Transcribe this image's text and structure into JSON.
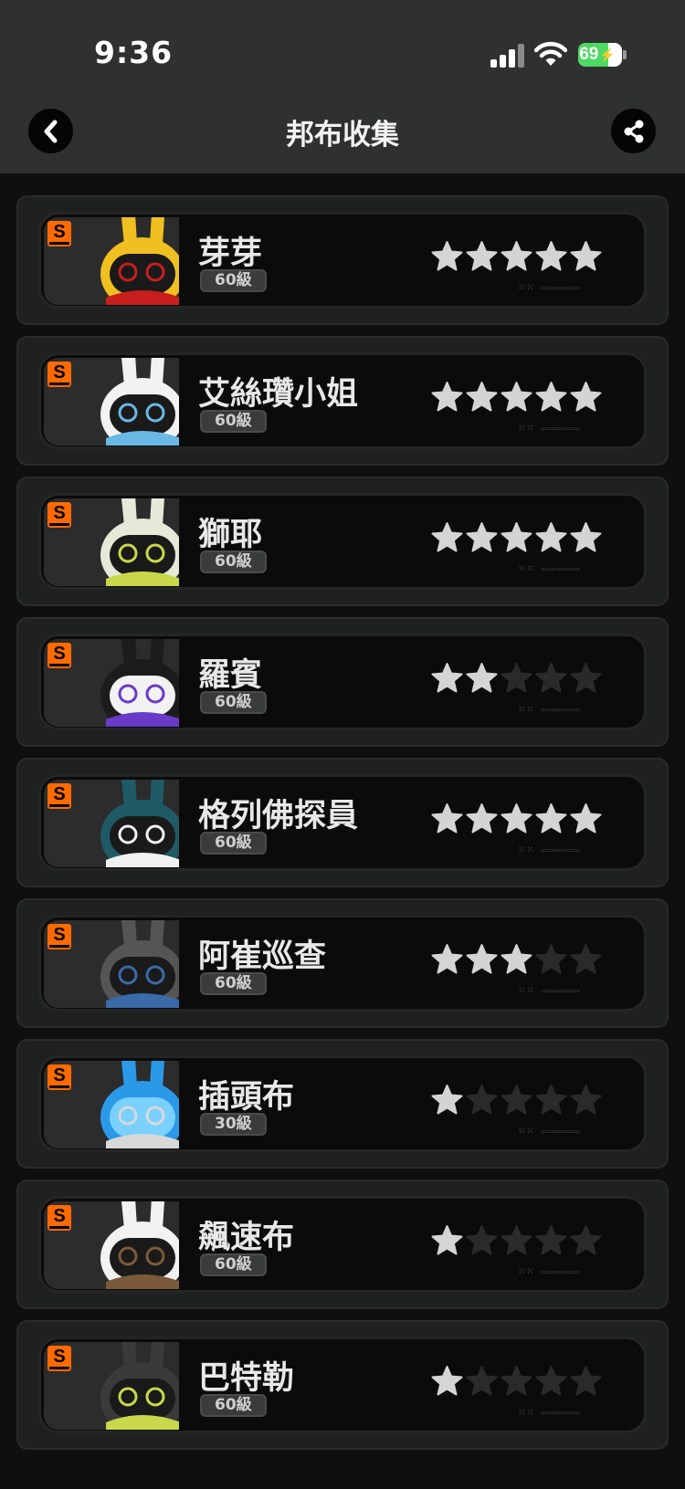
{
  "status": {
    "time": "9:36",
    "battery": "69",
    "battery_level": 69
  },
  "header": {
    "title": "邦布收集",
    "back_icon": "chevron-left-icon",
    "share_icon": "share-icon"
  },
  "colors": {
    "star_on": "#d4d4d4",
    "star_off": "#2a2a2a",
    "rank_s": "#ff6a00",
    "battery": "#4cd964"
  },
  "bangboo": [
    {
      "rank": "S",
      "name": "芽芽",
      "level": "60級",
      "stars": 5,
      "palette": [
        "#f0c020",
        "#1a1a1a",
        "#c81e1e"
      ]
    },
    {
      "rank": "S",
      "name": "艾絲瓚小姐",
      "level": "60級",
      "stars": 5,
      "palette": [
        "#f2f2f2",
        "#1a1a1a",
        "#6ab8e6"
      ]
    },
    {
      "rank": "S",
      "name": "獅耶",
      "level": "60級",
      "stars": 5,
      "palette": [
        "#e8e8d8",
        "#1a1a1a",
        "#c8d84a"
      ]
    },
    {
      "rank": "S",
      "name": "羅賓",
      "level": "60級",
      "stars": 2,
      "palette": [
        "#1c1c1c",
        "#f2f2f2",
        "#6a3ac8"
      ]
    },
    {
      "rank": "S",
      "name": "格列佛探員",
      "level": "60級",
      "stars": 5,
      "palette": [
        "#1f5a66",
        "#1a1a1a",
        "#f2f2f2"
      ]
    },
    {
      "rank": "S",
      "name": "阿崔巡查",
      "level": "60級",
      "stars": 3,
      "palette": [
        "#555555",
        "#1a1a1a",
        "#3a6aa8"
      ]
    },
    {
      "rank": "S",
      "name": "插頭布",
      "level": "30級",
      "stars": 1,
      "palette": [
        "#2a9ae8",
        "#7ad0ff",
        "#d8d8d8"
      ]
    },
    {
      "rank": "S",
      "name": "飆速布",
      "level": "60級",
      "stars": 1,
      "palette": [
        "#f2f2f2",
        "#1a1a1a",
        "#7a5a3a"
      ]
    },
    {
      "rank": "S",
      "name": "巴特勒",
      "level": "60級",
      "stars": 1,
      "palette": [
        "#3a3a3a",
        "#1a1a1a",
        "#c8d84a"
      ]
    }
  ]
}
